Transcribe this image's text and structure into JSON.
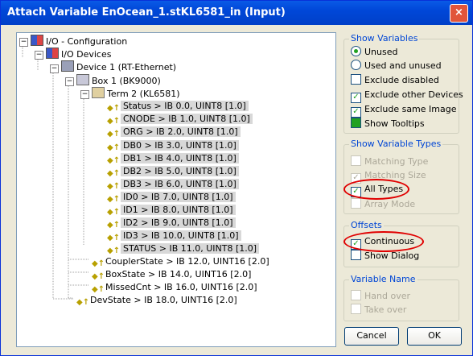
{
  "window": {
    "title": "Attach Variable EnOcean_1.stKL6581_in (Input)",
    "close": "×"
  },
  "tree": {
    "root": "I/O - Configuration",
    "devices": "I/O Devices",
    "device": "Device 1 (RT-Ethernet)",
    "box": "Box 1 (BK9000)",
    "term": "Term 2 (KL6581)",
    "vars": [
      "Status  >  IB 0.0, UINT8 [1.0]",
      "CNODE  >  IB 1.0, UINT8 [1.0]",
      "ORG  >  IB 2.0, UINT8 [1.0]",
      "DB0  >  IB 3.0, UINT8 [1.0]",
      "DB1  >  IB 4.0, UINT8 [1.0]",
      "DB2  >  IB 5.0, UINT8 [1.0]",
      "DB3  >  IB 6.0, UINT8 [1.0]",
      "ID0  >  IB 7.0, UINT8 [1.0]",
      "ID1  >  IB 8.0, UINT8 [1.0]",
      "ID2  >  IB 9.0, UINT8 [1.0]",
      "ID3  >  IB 10.0, UINT8 [1.0]",
      "STATUS  >  IB 11.0, UINT8 [1.0]"
    ],
    "box_vars": [
      "CouplerState  >  IB 12.0, UINT16 [2.0]",
      "BoxState  >  IB 14.0, UINT16 [2.0]",
      "MissedCnt  >  IB 16.0, UINT16 [2.0]"
    ],
    "devstate": "DevState  >  IB 18.0, UINT16 [2.0]"
  },
  "show_variables": {
    "label": "Show Variables",
    "unused": "Unused",
    "used_and_unused": "Used and unused",
    "exclude_disabled": "Exclude disabled",
    "exclude_other": "Exclude other Devices",
    "exclude_same": "Exclude same Image",
    "show_tooltips": "Show Tooltips"
  },
  "show_types": {
    "label": "Show Variable Types",
    "matching_type": "Matching Type",
    "matching_size": "Matching Size",
    "all_types": "All Types",
    "array_mode": "Array Mode"
  },
  "offsets": {
    "label": "Offsets",
    "continuous": "Continuous",
    "show_dialog": "Show Dialog"
  },
  "variable_name": {
    "label": "Variable Name",
    "hand_over": "Hand over",
    "take_over": "Take over"
  },
  "buttons": {
    "cancel": "Cancel",
    "ok": "OK"
  },
  "marks": {
    "check": "✓",
    "expanded": "−",
    "var_icon": "◆↑"
  }
}
